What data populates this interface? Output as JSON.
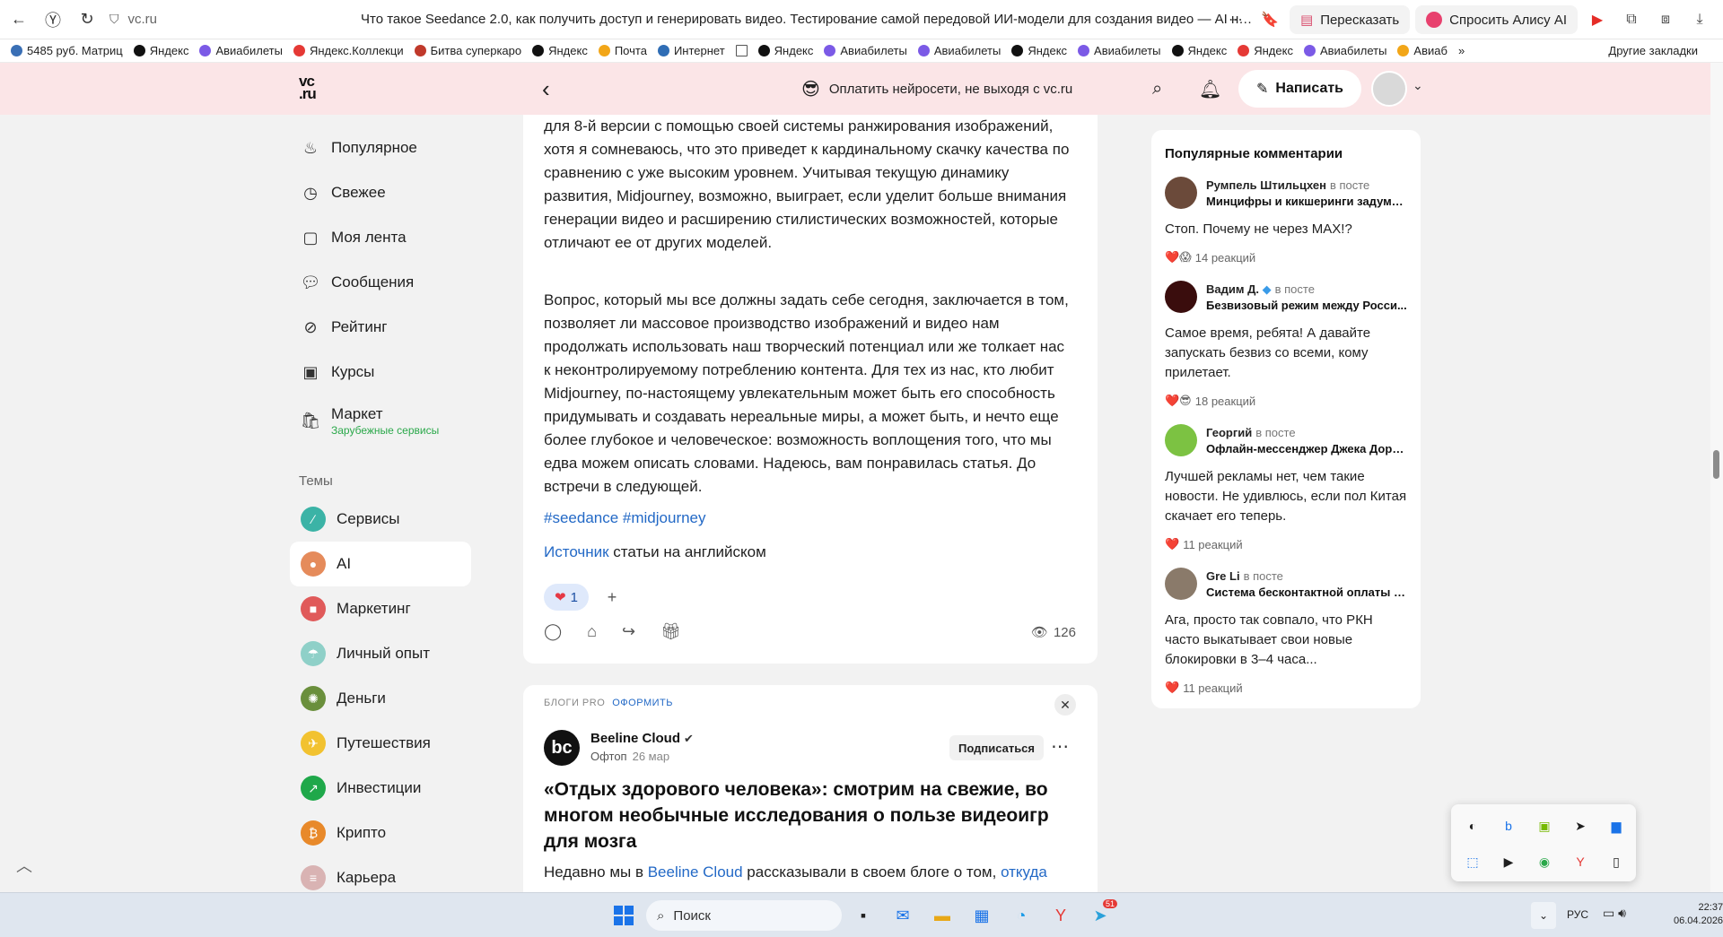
{
  "browser": {
    "url": "vc.ru",
    "title": "Что такое Seedance 2.0, как получить доступ и генерировать видео. Тестирование самой передовой ИИ-модели для создания видео — AI на vc.ru",
    "retell_label": "Пересказать",
    "alice_label": "Спросить Алису AI",
    "bookmarks": [
      "5485 руб. Матриц",
      "Яндекс",
      "Авиабилеты",
      "Яндекс.Коллекци",
      "Битва суперкаро",
      "Яндекс",
      "Почта",
      "Интернет",
      "",
      "Яндекс",
      "Авиабилеты",
      "Авиабилеты",
      "Яндекс",
      "Авиабилеты",
      "Яндекс",
      "Яндекс",
      "Авиабилеты",
      "Авиаб"
    ],
    "other_bookmarks": "Другие закладки"
  },
  "header": {
    "logo": "vc.ru",
    "logo_line1": "vc",
    "logo_line2": ".ru",
    "promo_text": "Оплатить нейросети, не выходя с vc.ru",
    "write_label": "Написать"
  },
  "sidebar": {
    "items": [
      {
        "label": "Популярное",
        "icon": "fire-icon"
      },
      {
        "label": "Свежее",
        "icon": "clock-icon"
      },
      {
        "label": "Моя лента",
        "icon": "feed-icon"
      },
      {
        "label": "Сообщения",
        "icon": "chat-icon"
      },
      {
        "label": "Рейтинг",
        "icon": "compass-icon"
      },
      {
        "label": "Курсы",
        "icon": "course-icon"
      }
    ],
    "market_label": "Маркет",
    "market_sub": "Зарубежные сервисы",
    "themes_heading": "Темы",
    "themes": [
      {
        "label": "Сервисы",
        "color": "#3bb3a6"
      },
      {
        "label": "AI",
        "color": "#e58b5b"
      },
      {
        "label": "Маркетинг",
        "color": "#e05a5a"
      },
      {
        "label": "Личный опыт",
        "color": "#8fd0c8"
      },
      {
        "label": "Деньги",
        "color": "#6a8f3c"
      },
      {
        "label": "Путешествия",
        "color": "#f2c230"
      },
      {
        "label": "Инвестиции",
        "color": "#1fa84a"
      },
      {
        "label": "Крипто",
        "color": "#e8892a"
      },
      {
        "label": "Карьера",
        "color": "#d9b3b3"
      }
    ]
  },
  "article": {
    "para1": "для 8-й версии с помощью своей системы ранжирования изображений, хотя я сомневаюсь, что это приведет к кардинальному скачку качества по сравнению с уже высоким уровнем. Учитывая текущую динамику развития, Midjourney, возможно, выиграет, если уделит больше внимания генерации видео и расширению стилистических возможностей, которые отличают ее от других моделей.",
    "para2": "Вопрос, который мы все должны задать себе сегодня, заключается в том, позволяет ли массовое производство изображений и видео нам продолжать использовать наш творческий потенциал или же толкает нас к неконтролируемому потреблению контента. Для тех из нас, кто любит Midjourney, по-настоящему увлекательным может быть его способность придумывать и создавать нереальные миры, а может быть, и нечто еще более глубокое и человеческое: возможность воплощения того, что мы едва можем описать словами. Надеюсь, вам понравилась статья. До встречи в следующей.",
    "tags": "#seedance #midjourney",
    "source_link": "Источник",
    "source_rest": " статьи на английском",
    "reaction_count": "1",
    "views": "126"
  },
  "promo_card": {
    "pro_label": "БЛОГИ PRO",
    "pro_action": "ОФОРМИТЬ",
    "author": "Beeline Cloud",
    "author_initials": "bc",
    "section": "Офтоп",
    "date": "26 мар",
    "subscribe": "Подписаться",
    "title": "«Отдых здорового человека»: смотрим на свежие, во многом необычные исследования о пользе видеоигр для мозга",
    "text_start": "Недавно мы в ",
    "text_link": "Beeline Cloud",
    "text_mid": " рассказывали в своем блоге о том, ",
    "text_link2": "откуда"
  },
  "comments": {
    "heading": "Популярные комментарии",
    "in_post": "в посте",
    "items": [
      {
        "author": "Румпель Штильцхен",
        "post": "Минцифры и кикшеринги задумал...",
        "text": "Стоп. Почему не через MAX!?",
        "reactions": "14 реакций",
        "emoji": "❤️😱",
        "color": "#6b4a3a"
      },
      {
        "author": "Вадим Д.",
        "post": "Безвизовый режим между Росси...",
        "text": "Самое время, ребята! А давайте запускать безвиз со всеми, кому прилетает.",
        "reactions": "18 реакций",
        "emoji": "❤️😎",
        "color": "#3a0d0d"
      },
      {
        "author": "Георгий",
        "post": "Офлайн-мессенджер Джека Дорс...",
        "text": "Лучшей рекламы нет, чем такие новости. Не удивлюсь, если пол Китая скачает его теперь.",
        "reactions": "11 реакций",
        "emoji": "❤️",
        "color": "#7cc242"
      },
      {
        "author": "Gre Li",
        "post": "Система бесконтактной оплаты V...",
        "text": "Ага, просто так совпало, что РКН часто выкатывает свои новые блокировки в 3–4 часа...",
        "reactions": "11 реакций",
        "emoji": "❤️",
        "color": "#8a7a6a"
      }
    ]
  },
  "taskbar": {
    "search_label": "Поиск",
    "badge": "51",
    "lang": "РУС",
    "time": "22:37",
    "date": "06.04.2026"
  }
}
